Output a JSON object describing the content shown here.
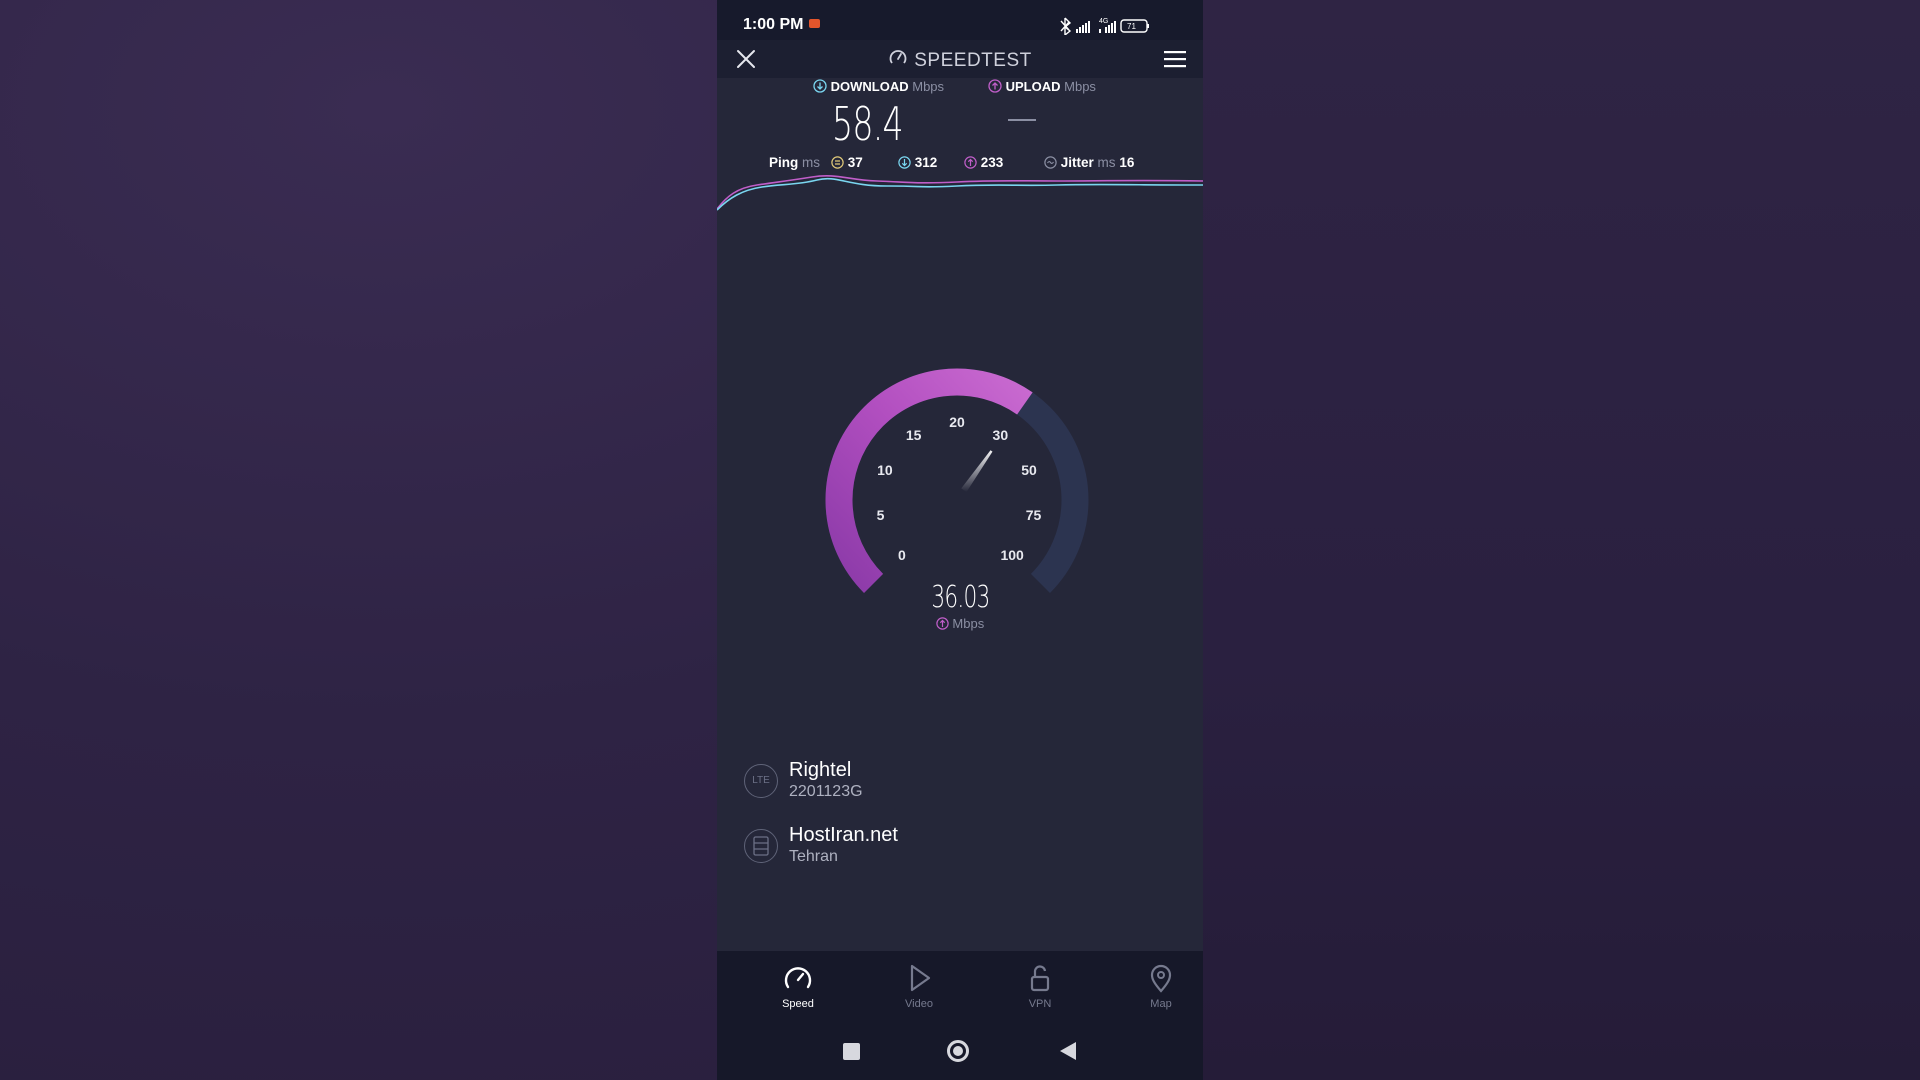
{
  "status_bar": {
    "time": "1:00 PM",
    "network_label": "4G",
    "battery": "71"
  },
  "app_bar": {
    "title": "SPEEDTEST",
    "close_icon": "close-icon",
    "menu_icon": "hamburger-menu-icon"
  },
  "results": {
    "download": {
      "label": "DOWNLOAD",
      "unit": "Mbps",
      "value": "58.4"
    },
    "upload": {
      "label": "UPLOAD",
      "unit": "Mbps",
      "value": ""
    }
  },
  "ping": {
    "label": "Ping",
    "unit": "ms",
    "idle": "37",
    "download": "312",
    "upload": "233",
    "jitter_label": "Jitter",
    "jitter_unit": "ms",
    "jitter": "16"
  },
  "gauge": {
    "ticks": [
      "0",
      "5",
      "10",
      "15",
      "20",
      "30",
      "50",
      "75",
      "100"
    ],
    "current_value": "36.03",
    "current_value_numeric": 36.03,
    "unit": "Mbps",
    "progress_fraction": 0.63
  },
  "connection": {
    "provider": {
      "icon_text": "LTE",
      "name": "Rightel",
      "detail": "2201123G"
    },
    "server": {
      "name": "HostIran.net",
      "location": "Tehran"
    }
  },
  "tabs": [
    {
      "label": "Speed",
      "icon": "speedometer-icon",
      "active": true
    },
    {
      "label": "Video",
      "icon": "play-icon",
      "active": false
    },
    {
      "label": "VPN",
      "icon": "lock-icon",
      "active": false
    },
    {
      "label": "Map",
      "icon": "map-pin-icon",
      "active": false
    }
  ],
  "colors": {
    "accent_purple": "#c05ec9",
    "accent_cyan": "#7ad6f0",
    "gauge_track": "#2c3450"
  }
}
